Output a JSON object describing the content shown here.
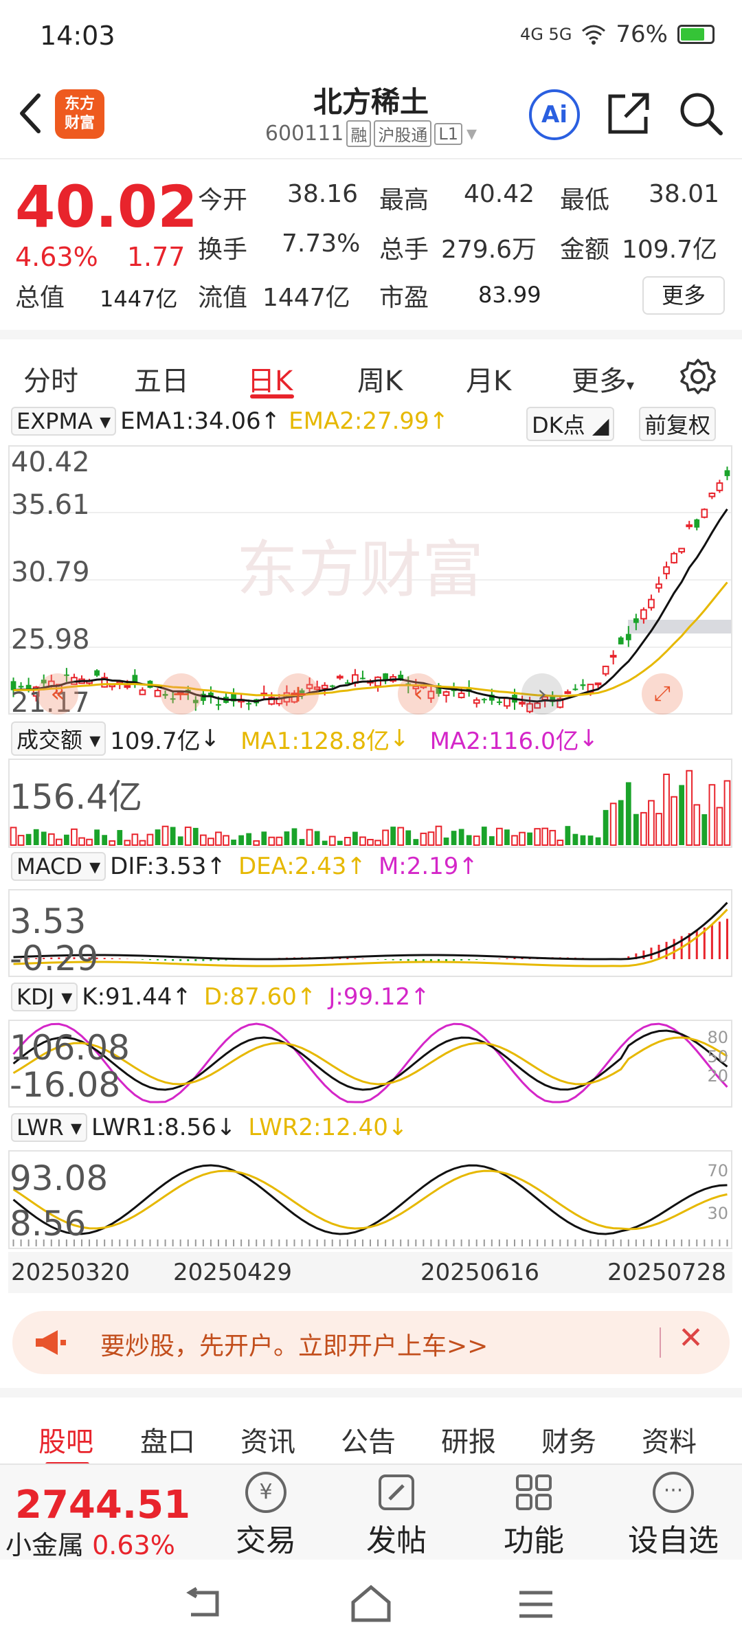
{
  "status": {
    "time": "14:03",
    "battery": "76%",
    "network": "4G 5G"
  },
  "header": {
    "logo_text": "东方\n财富",
    "name": "北方稀土",
    "code": "600111",
    "tags": [
      "融",
      "沪股通",
      "L1"
    ]
  },
  "quote": {
    "price": "40.02",
    "pct": "4.63%",
    "chg": "1.77",
    "open_label": "今开",
    "open": "38.16",
    "high_label": "最高",
    "high": "40.42",
    "low_label": "最低",
    "low": "38.01",
    "turnover_label": "换手",
    "turnover": "7.73%",
    "vol_label": "总手",
    "vol": "279.6万",
    "amount_label": "金额",
    "amount": "109.7亿",
    "mktcap_label": "总值",
    "mktcap": "1447亿",
    "float_label": "流值",
    "float": "1447亿",
    "pe_label": "市盈",
    "pe": "83.99",
    "more": "更多"
  },
  "tabs": {
    "items": [
      "分时",
      "五日",
      "日K",
      "周K",
      "月K",
      "更多"
    ],
    "active": "日K"
  },
  "expma": {
    "name": "EXPMA",
    "ema1": "EMA1:34.06",
    "ema2": "EMA2:27.99",
    "dk": "DK点",
    "fq": "前复权",
    "y": [
      "40.42",
      "35.61",
      "30.79",
      "25.98",
      "21.17"
    ],
    "watermark": "东方财富"
  },
  "volume": {
    "name": "成交额",
    "val": "109.7亿",
    "ma1": "MA1:128.8亿",
    "ma2": "MA2:116.0亿",
    "y": "156.4亿"
  },
  "macd": {
    "name": "MACD",
    "dif": "DIF:3.53",
    "dea": "DEA:2.43",
    "m": "M:2.19",
    "y1": "3.53",
    "y2": "-0.29"
  },
  "kdj": {
    "name": "KDJ",
    "k": "K:91.44",
    "d": "D:87.60",
    "j": "J:99.12",
    "y1": "106.08",
    "y2": "-16.08",
    "r": [
      "80",
      "50",
      "20"
    ]
  },
  "lwr": {
    "name": "LWR",
    "l1": "LWR1:8.56",
    "l2": "LWR2:12.40",
    "y1": "93.08",
    "y2": "8.56",
    "r": [
      "70",
      "30"
    ]
  },
  "dates": [
    "20250320",
    "20250429",
    "20250616",
    "20250728"
  ],
  "banner": {
    "text": "要炒股，先开户。立即开户上车>>"
  },
  "subtabs": [
    "股吧",
    "盘口",
    "资讯",
    "公告",
    "研报",
    "财务",
    "资料"
  ],
  "bottom": {
    "index_value": "2744.51",
    "index_name": "小金属",
    "index_pct": "0.63%",
    "trade": "交易",
    "post": "发帖",
    "func": "功能",
    "watch": "设自选"
  },
  "colors": {
    "red": "#e8242c",
    "green": "#1aa32a",
    "yellow": "#e6b800",
    "magenta": "#d426c8"
  }
}
